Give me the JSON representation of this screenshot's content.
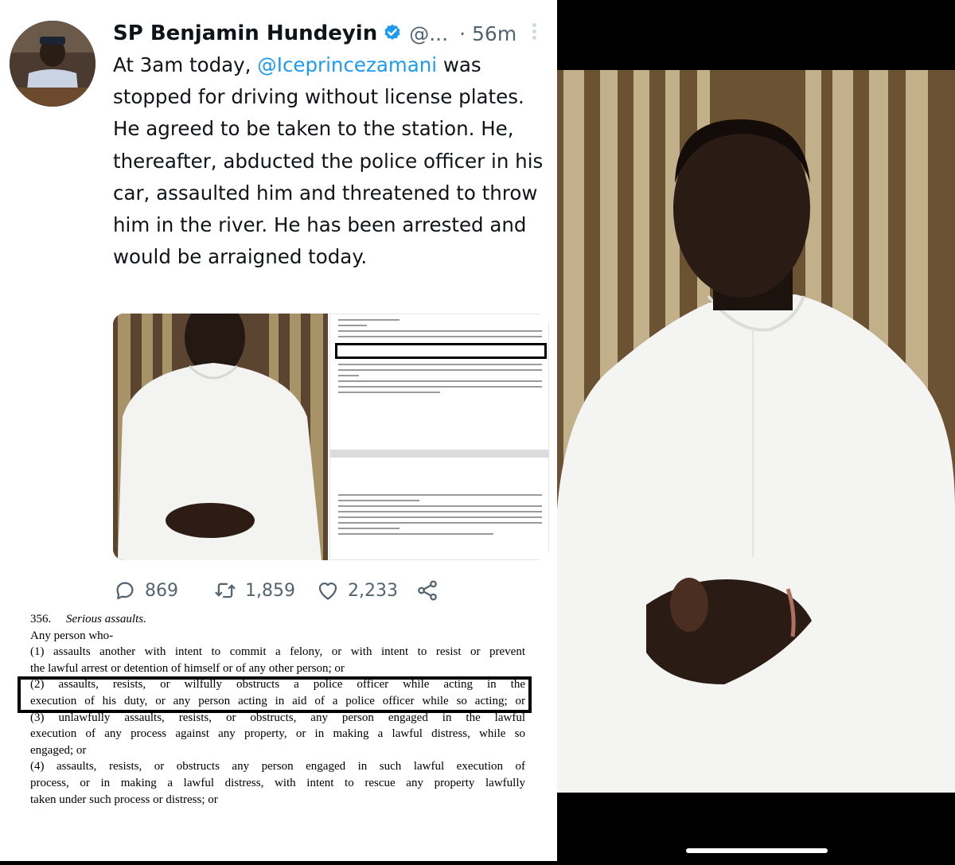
{
  "tweet": {
    "author_name": "SP Benjamin Hundeyin",
    "handle": "@...",
    "separator": "·",
    "time": "56m",
    "text_before_mention": "At 3am today, ",
    "mention": "@Iceprincezamani",
    "text_after_mention": " was stopped for driving without license plates. He agreed to be taken to the station. He, thereafter, abducted the police officer in his car, assaulted him and threatened to throw him in the river. He has been arrested and would be arraigned today.",
    "replies": "869",
    "retweets": "1,859",
    "likes": "2,233"
  },
  "law": {
    "heading_number": "356.",
    "heading_title": "Serious assaults.",
    "intro": "Any person who-",
    "clause1_a": "(1)    assaults another with intent to commit a felony, or with intent to resist or prevent",
    "clause1_b": "the lawful arrest or detention of himself or of any other person; or",
    "clause2_a": "(2)        assaults, resists, or wilfully obstructs a police officer while acting in the",
    "clause2_b": "execution of his duty, or any person acting in aid of a police officer while so acting; or",
    "clause3_a": "(3)        unlawfully assaults, resists, or obstructs, any person engaged in the lawful",
    "clause3_b": "execution of any process against any property, or in making a lawful distress, while so",
    "clause3_c": "engaged; or",
    "clause4_a": "(4)      assaults, resists, or obstructs any person engaged in such lawful execution of",
    "clause4_b": "process, or in making a lawful distress, with intent to rescue any property lawfully",
    "clause4_c": "taken under such process or distress; or"
  },
  "icons": [
    "verified-badge-icon",
    "more-icon",
    "reply-icon",
    "retweet-icon",
    "like-icon",
    "share-icon"
  ],
  "colors": {
    "mention": "#1d9bf0",
    "verified": "#1d9bf0",
    "secondary_text": "#536471"
  }
}
